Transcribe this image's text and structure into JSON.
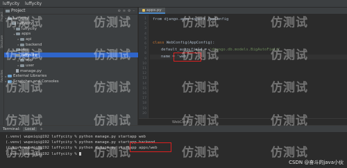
{
  "window": {
    "title_left": "luffycity",
    "title_right": "luffycity"
  },
  "tool_strip": {
    "project": "Project",
    "structure": "Structure",
    "favorites": "Favorites"
  },
  "project_panel": {
    "label": "Project",
    "tools": [
      "⊕",
      "≡",
      "⚙",
      "–"
    ],
    "tree": [
      {
        "label": "luffycity",
        "kind": "folder",
        "arrow": "▾",
        "selected": false
      },
      {
        "label": "luffycity",
        "kind": "folder",
        "arrow": "▾",
        "selected": false
      },
      {
        "label": "luffycity",
        "kind": "folder",
        "arrow": "▾",
        "selected": false
      },
      {
        "label": "apps",
        "kind": "folder",
        "arrow": "▾",
        "selected": false
      },
      {
        "label": "api",
        "kind": "folder",
        "arrow": "▸",
        "selected": false
      },
      {
        "label": "backend",
        "kind": "folder",
        "arrow": "▸",
        "selected": false
      },
      {
        "label": "libs",
        "kind": "folder",
        "arrow": "▸",
        "selected": false
      },
      {
        "label": "luffycity",
        "kind": "folder",
        "arrow": "▸",
        "selected": true
      },
      {
        "label": "app",
        "kind": "folder",
        "arrow": "▸",
        "selected": false
      },
      {
        "label": "user",
        "kind": "folder",
        "arrow": "▸",
        "selected": false
      },
      {
        "label": "manage.py",
        "kind": "file",
        "arrow": "",
        "selected": false
      },
      {
        "label": "External Libraries",
        "kind": "lib",
        "arrow": "▸",
        "selected": false
      },
      {
        "label": "Scratches and Consoles",
        "kind": "lib",
        "arrow": "▸",
        "selected": false
      }
    ]
  },
  "editor": {
    "tab_label": "apps.py",
    "breadcrumb": "WebConfig",
    "code": {
      "l1": "from django.apps import AppConfig",
      "l2_kw": "class",
      "l2_rest": " WebConfig(AppConfig):",
      "l3_a": "default_auto_field = ",
      "l3_b": "'django.db.models.BigAutoField'",
      "l4": "name = 'web'"
    },
    "line_numbers": [
      "1",
      "2",
      "3",
      "4",
      "5",
      "6",
      "7",
      "8",
      "9",
      "10",
      "11",
      "12",
      "13",
      "14",
      "15",
      "16",
      "17",
      "18",
      "19",
      "20"
    ]
  },
  "terminal": {
    "title": "Terminal:",
    "tab": "Local",
    "add": "+",
    "lines": [
      "(.venv) wupeiqi@192 luffycity % python manage.py startapp web",
      "(.venv) wupeiqi@192 luffycity % python manage.py startapp backend",
      "(.venv) wupeiqi@192 luffycity % python manage.py startapp apps/web",
      "(.venv) wupeiqi@192 luffycity % "
    ]
  },
  "watermark": {
    "text": "仿测试"
  },
  "credit": "CSDN @奋斗的java小伙"
}
